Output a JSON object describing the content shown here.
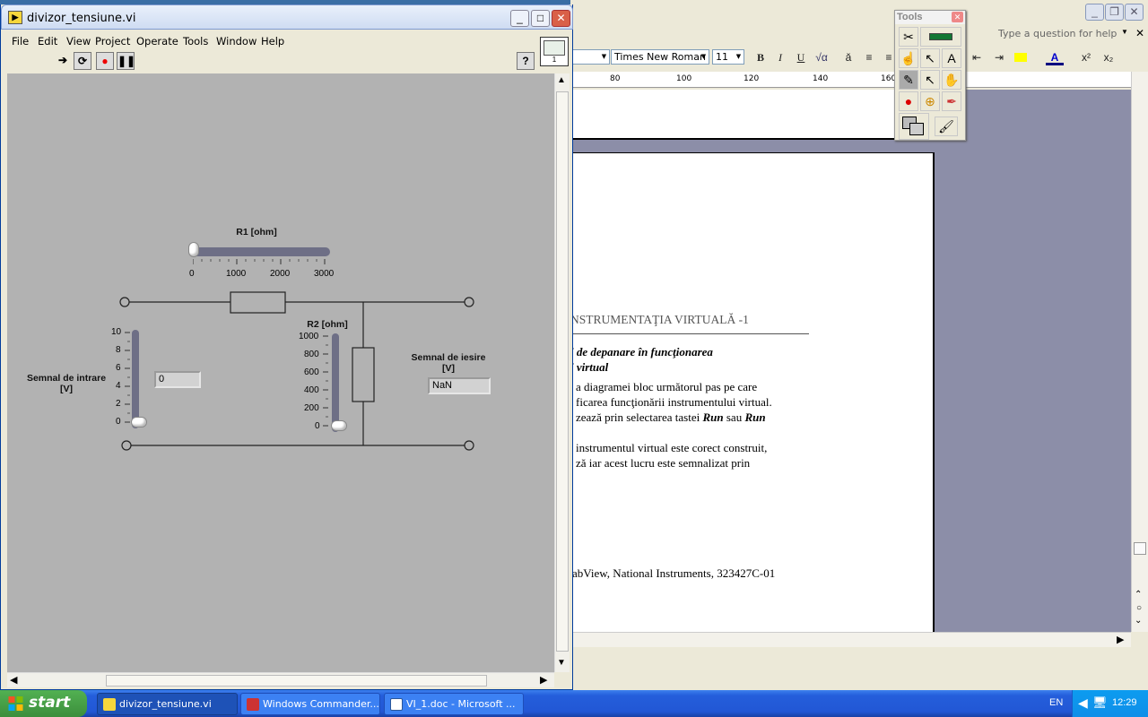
{
  "word": {
    "help_placeholder": "Type a question for help",
    "font_name": "Times New Roman",
    "font_size": "11",
    "ruler": [
      "80",
      "100",
      "120",
      "140",
      "160"
    ],
    "doc": {
      "heading": "NSTRUMENTAŢIA VIRTUALĂ -1",
      "line1": "i    de    depanare    în    funcţionarea",
      "line2": "i virtual",
      "p1": "a  diagramei bloc următorul pas pe care",
      "p2": "ficarea  funcţionării  instrumentului  virtual.",
      "p3a": "zează prin selectarea tastei ",
      "p3b": "Run",
      "p3c": " sau ",
      "p3d": "Run",
      "p4": "instrumentul virtual este corect construit,",
      "p5": "ză iar acest lucru este semnalizat prin",
      "footnote": "abView, National Instruments, 323427C-01"
    }
  },
  "tools_palette": {
    "title": "Tools"
  },
  "labview": {
    "title": "divizor_tensiune.vi",
    "menu": [
      "File",
      "Edit",
      "View",
      "Project",
      "Operate",
      "Tools",
      "Window",
      "Help"
    ],
    "connector_label": "1",
    "r1": {
      "label": "R1 [ohm]",
      "ticks": [
        "0",
        "1000",
        "2000",
        "3000"
      ],
      "value_fraction": 0
    },
    "r2": {
      "label": "R2 [ohm]",
      "ticks": [
        "1000",
        "800",
        "600",
        "400",
        "200",
        "0"
      ],
      "value_fraction": 0
    },
    "input": {
      "label_line1": "Semnal de intrare",
      "label_line2": "[V]",
      "ticks": [
        "10",
        "8",
        "6",
        "4",
        "2",
        "0"
      ],
      "value": "0",
      "value_fraction": 0
    },
    "output": {
      "label_line1": "Semnal de iesire",
      "label_line2": "[V]",
      "value": "NaN"
    }
  },
  "taskbar": {
    "start": "start",
    "tasks": [
      "divizor_tensiune.vi",
      "Windows Commander...",
      "VI_1.doc - Microsoft ..."
    ],
    "lang": "EN",
    "clock": "12:29"
  }
}
